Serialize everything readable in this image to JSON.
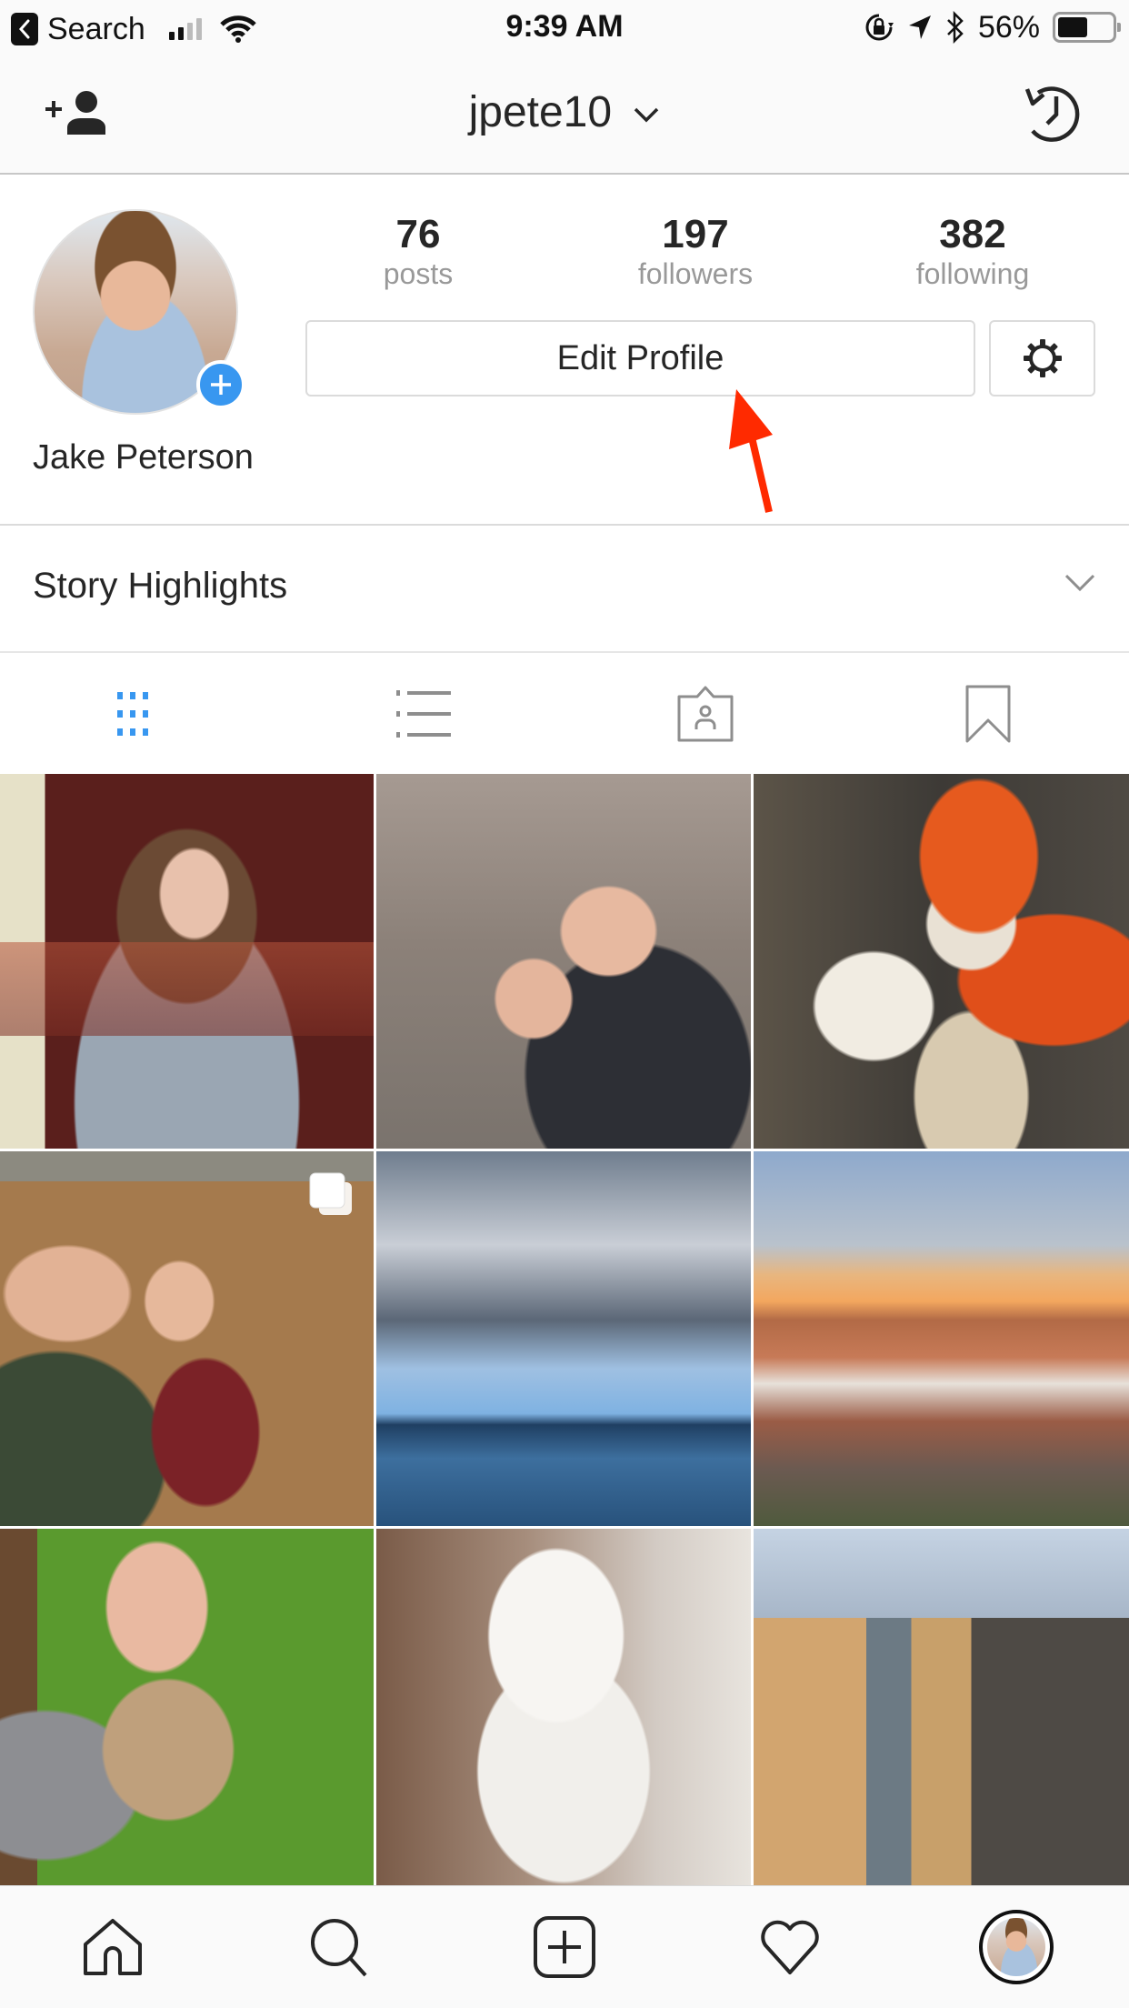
{
  "status_bar": {
    "back_app": "Search",
    "time": "9:39 AM",
    "battery_percent": "56%",
    "battery_level": 0.56,
    "signal_bars_active": 2,
    "signal_bars_total": 4,
    "icons": [
      "back-icon",
      "signal-icon",
      "wifi-icon",
      "orientation-lock-icon",
      "location-icon",
      "bluetooth-icon",
      "battery-icon"
    ]
  },
  "top_nav": {
    "username": "jpete10",
    "left_icon": "add-user-icon",
    "right_icon": "history-icon",
    "dropdown_icon": "chevron-down-icon"
  },
  "profile": {
    "full_name": "Jake Peterson",
    "stats": [
      {
        "value": "76",
        "label": "posts"
      },
      {
        "value": "197",
        "label": "followers"
      },
      {
        "value": "382",
        "label": "following"
      }
    ],
    "edit_profile_label": "Edit Profile",
    "settings_icon": "gear-icon",
    "avatar_badge_icon": "plus-icon"
  },
  "annotation": {
    "arrow_color": "#ff2a00",
    "arrow_target": "Edit Profile"
  },
  "highlights": {
    "title": "Story Highlights"
  },
  "tabs": [
    {
      "name": "grid",
      "icon": "grid-icon",
      "active": true
    },
    {
      "name": "list",
      "icon": "list-icon",
      "active": false
    },
    {
      "name": "tagged",
      "icon": "tagged-icon",
      "active": false
    },
    {
      "name": "saved",
      "icon": "bookmark-icon",
      "active": false
    }
  ],
  "grid": {
    "posts": [
      {
        "description": "woman with glasses drinking from glass",
        "multi": false
      },
      {
        "description": "couple selfie outdoors",
        "multi": false
      },
      {
        "description": "crocheted tiger plush",
        "multi": false
      },
      {
        "description": "couple selfie in autumn leaves",
        "multi": true
      },
      {
        "description": "cloudy sky over marina",
        "multi": false
      },
      {
        "description": "city skyline at sunset",
        "multi": false
      },
      {
        "description": "woman holding a dog",
        "multi": false
      },
      {
        "description": "white fluffy dog",
        "multi": false
      },
      {
        "description": "city street buildings",
        "multi": false
      }
    ]
  },
  "bottom_nav": [
    {
      "name": "home",
      "icon": "home-icon"
    },
    {
      "name": "search",
      "icon": "search-icon"
    },
    {
      "name": "new-post",
      "icon": "plus-square-icon"
    },
    {
      "name": "activity",
      "icon": "heart-icon"
    },
    {
      "name": "profile",
      "icon": "profile-avatar"
    }
  ],
  "colors": {
    "accent_blue": "#3897f0",
    "text_primary": "#262626",
    "text_secondary": "#999999",
    "border": "#dbdbdb"
  }
}
